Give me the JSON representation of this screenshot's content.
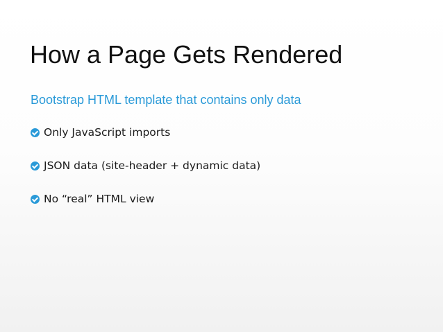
{
  "slide": {
    "title": "How a Page Gets Rendered",
    "subtitle": "Bootstrap HTML template that contains only data",
    "bullets": [
      {
        "text": "Only JavaScript imports",
        "icon": "check-circle-icon"
      },
      {
        "text": "JSON data (site-header + dynamic data)",
        "icon": "check-circle-icon"
      },
      {
        "text": "No “real” HTML view",
        "icon": "check-circle-icon"
      }
    ]
  },
  "colors": {
    "accent": "#2a9ad8",
    "title": "#111111",
    "body": "#1a1a1a",
    "background": "#ffffff"
  }
}
